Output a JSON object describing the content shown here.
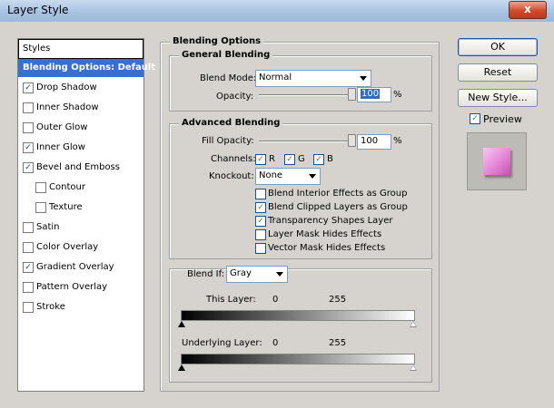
{
  "window": {
    "title": "Layer Style",
    "close_glyph": "x"
  },
  "styles": {
    "header": "Styles",
    "items": [
      {
        "label": "Blending Options: Default",
        "checkbox": false,
        "selected": true
      },
      {
        "label": "Drop Shadow",
        "checkbox": true,
        "checked": true
      },
      {
        "label": "Inner Shadow",
        "checkbox": true,
        "checked": false
      },
      {
        "label": "Outer Glow",
        "checkbox": true,
        "checked": false
      },
      {
        "label": "Inner Glow",
        "checkbox": true,
        "checked": true
      },
      {
        "label": "Bevel and Emboss",
        "checkbox": true,
        "checked": true
      },
      {
        "label": "Contour",
        "checkbox": true,
        "checked": false,
        "indent": true
      },
      {
        "label": "Texture",
        "checkbox": true,
        "checked": false,
        "indent": true
      },
      {
        "label": "Satin",
        "checkbox": true,
        "checked": false
      },
      {
        "label": "Color Overlay",
        "checkbox": true,
        "checked": false
      },
      {
        "label": "Gradient Overlay",
        "checkbox": true,
        "checked": true
      },
      {
        "label": "Pattern Overlay",
        "checkbox": true,
        "checked": false
      },
      {
        "label": "Stroke",
        "checkbox": true,
        "checked": false
      }
    ]
  },
  "blending_options": {
    "legend": "Blending Options",
    "general": {
      "legend": "General Blending",
      "blend_mode_label": "Blend Mode:",
      "blend_mode_value": "Normal",
      "opacity_label": "Opacity:",
      "opacity_value": "100",
      "opacity_unit": "%",
      "opacity_level": 1.0
    },
    "advanced": {
      "legend": "Advanced Blending",
      "fill_opacity_label": "Fill Opacity:",
      "fill_opacity_value": "100",
      "fill_opacity_unit": "%",
      "fill_opacity_level": 1.0,
      "channels_label": "Channels:",
      "channels": [
        "R",
        "G",
        "B"
      ],
      "knockout_label": "Knockout:",
      "knockout_value": "None",
      "checkboxes": [
        {
          "label": "Blend Interior Effects as Group",
          "checked": false
        },
        {
          "label": "Blend Clipped Layers as Group",
          "checked": true
        },
        {
          "label": "Transparency Shapes Layer",
          "checked": true
        },
        {
          "label": "Layer Mask Hides Effects",
          "checked": false
        },
        {
          "label": "Vector Mask Hides Effects",
          "checked": false
        }
      ]
    },
    "blend_if": {
      "label": "Blend If:",
      "value": "Gray",
      "this_layer_label": "This Layer:",
      "this_layer_min": "0",
      "this_layer_max": "255",
      "underlying_label": "Underlying Layer:",
      "underlying_min": "0",
      "underlying_max": "255"
    }
  },
  "buttons": {
    "ok": "OK",
    "reset": "Reset",
    "new_style": "New Style...",
    "preview_label": "Preview",
    "preview_checked": true
  }
}
